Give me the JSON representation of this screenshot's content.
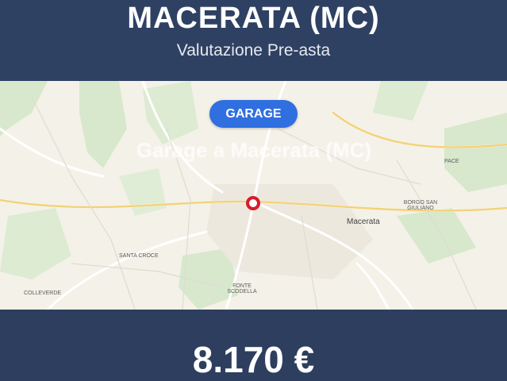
{
  "header": {
    "title": "MACERATA (MC)",
    "subtitle": "Valutazione Pre-asta"
  },
  "badge": {
    "label": "GARAGE"
  },
  "watermark": {
    "text": "Garage a Macerata (MC)"
  },
  "map": {
    "labels": {
      "macerata": "Macerata",
      "borgo_san_giuliano": "BORGO SAN GIULIANO",
      "santa_croce": "SANTA CROCE",
      "collevario": "COLLEVERDE",
      "fonte_scodella": "FONTE SCODELLA",
      "pace": "PACE"
    }
  },
  "price": {
    "value": "8.170 €"
  },
  "colors": {
    "header_bg": "#2f4163",
    "badge_bg": "#2f6fe0",
    "pin": "#d81b2b",
    "map_bg": "#f4f1e8",
    "park_green": "#cfe3c2"
  }
}
